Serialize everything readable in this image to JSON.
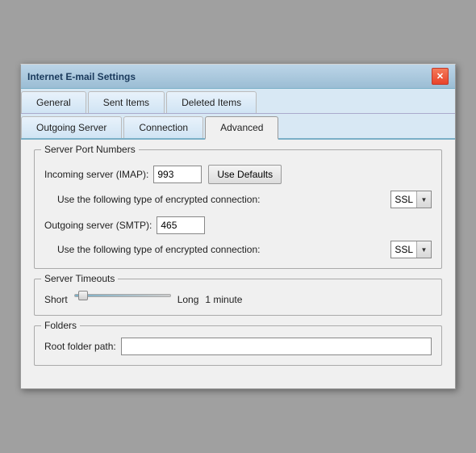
{
  "window": {
    "title": "Internet E-mail Settings",
    "close_label": "✕"
  },
  "tabs": {
    "row1": [
      {
        "id": "general",
        "label": "General",
        "active": false
      },
      {
        "id": "sent-items",
        "label": "Sent Items",
        "active": false
      },
      {
        "id": "deleted-items",
        "label": "Deleted Items",
        "active": false
      }
    ],
    "row2": [
      {
        "id": "outgoing-server",
        "label": "Outgoing Server",
        "active": false
      },
      {
        "id": "connection",
        "label": "Connection",
        "active": false
      },
      {
        "id": "advanced",
        "label": "Advanced",
        "active": true
      }
    ]
  },
  "server_port": {
    "group_label": "Server Port Numbers",
    "incoming_label": "Incoming server (IMAP):",
    "incoming_value": "993",
    "use_defaults_label": "Use Defaults",
    "enc_label1": "Use the following type of encrypted connection:",
    "enc_value1": "SSL",
    "outgoing_label": "Outgoing server (SMTP):",
    "outgoing_value": "465",
    "enc_label2": "Use the following type of encrypted connection:",
    "enc_value2": "SSL"
  },
  "server_timeouts": {
    "group_label": "Server Timeouts",
    "short_label": "Short",
    "long_label": "Long",
    "timeout_value": "1 minute"
  },
  "folders": {
    "group_label": "Folders",
    "root_folder_label": "Root folder path:",
    "root_folder_value": ""
  }
}
